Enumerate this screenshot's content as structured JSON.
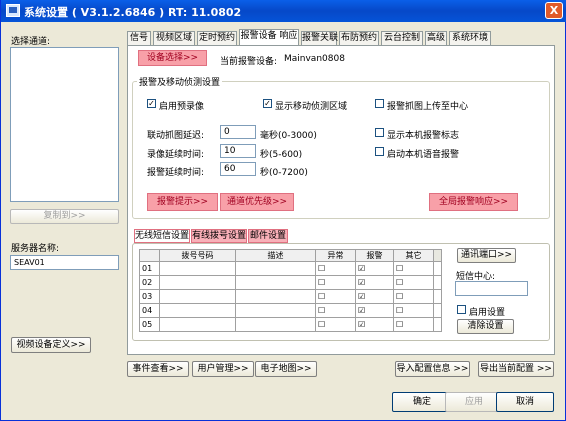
{
  "window": {
    "title": "系统设置 ( V3.1.2.6846 ) RT: 11.0802",
    "close": "X"
  },
  "left": {
    "select_channel": "选择通道:",
    "copy_to": "复制到>>",
    "server_name_label": "服务器名称:",
    "server_name": "SEAV01",
    "video_def": "视频设备定义>>"
  },
  "tabs": [
    "信号",
    "视频区域",
    "定时预约",
    "报警设备 响应",
    "报警关联",
    "布防预约",
    "云台控制",
    "高级",
    "系统环境"
  ],
  "device": {
    "select": "设备选择>>",
    "current_label": "当前报警设备:",
    "current": "Mainvan0808"
  },
  "group": {
    "title": "报警及移动侦测设置",
    "enable_record": "启用预录像",
    "show_motion": "显示移动侦测区域",
    "upload_alarm": "报警抓图上传至中心",
    "link_delay": "联动抓图延迟:",
    "link_delay_val": "0",
    "link_delay_unit": "毫秒(0-3000)",
    "rec_delay": "录像延续时间:",
    "rec_delay_val": "10",
    "rec_delay_unit": "秒(5-600)",
    "alarm_delay": "报警延续时间:",
    "alarm_delay_val": "60",
    "alarm_delay_unit": "秒(0-7200)",
    "show_local": "显示本机报警标志",
    "voice": "启动本机语音报警",
    "alarm_tip": "报警提示>>",
    "channel_pri": "通道优先级>>",
    "global": "全局报警响应>>"
  },
  "sms": {
    "tabs": [
      "无线短信设置",
      "有线拨号设置",
      "邮件设置"
    ],
    "headers": [
      "",
      "拨号号码",
      "描述",
      "异常",
      "报警",
      "其它"
    ],
    "rows": [
      {
        "n": "01",
        "alarm": true
      },
      {
        "n": "02",
        "alarm": true
      },
      {
        "n": "03",
        "alarm": true
      },
      {
        "n": "04",
        "alarm": true
      },
      {
        "n": "05",
        "alarm": true
      }
    ],
    "comm_port": "通讯端口>>",
    "center": "短信中心:",
    "enable": "启用设置",
    "clear": "清除设置"
  },
  "bottom": {
    "event": "事件查看>>",
    "user": "用户管理>>",
    "emap": "电子地图>>",
    "import": "导入配置信息 >>",
    "export": "导出当前配置 >>",
    "ok": "确定",
    "apply": "应用",
    "cancel": "取消"
  }
}
